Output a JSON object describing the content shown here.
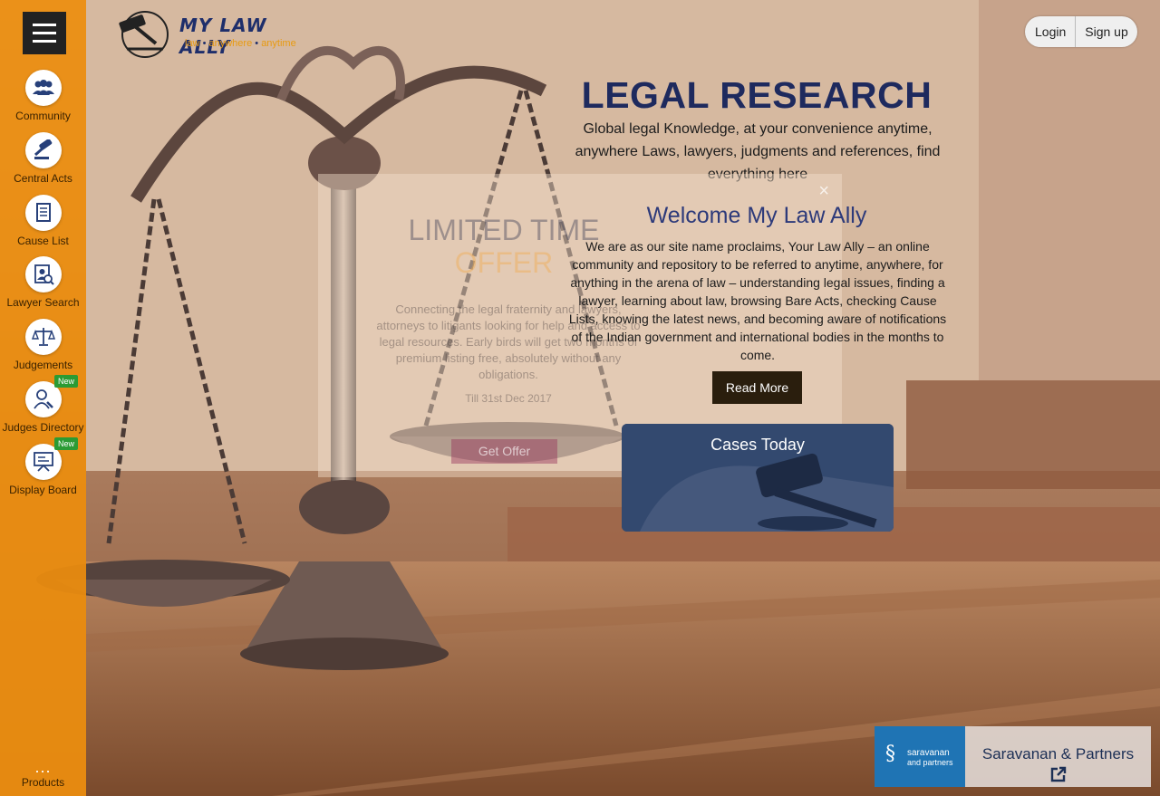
{
  "sidebar": {
    "items": [
      {
        "label": "Community",
        "icon": "community-icon"
      },
      {
        "label": "Central Acts",
        "icon": "gavel-icon"
      },
      {
        "label": "Cause List",
        "icon": "document-list-icon"
      },
      {
        "label": "Lawyer Search",
        "icon": "lawyer-search-icon"
      },
      {
        "label": "Judgements",
        "icon": "scales-icon"
      },
      {
        "label": "Judges Directory",
        "icon": "judge-icon",
        "badge": "New"
      },
      {
        "label": "Display Board",
        "icon": "display-board-icon",
        "badge": "New"
      }
    ],
    "products_label": "Products",
    "more_glyph": "..."
  },
  "logo": {
    "title": "MY LAW ALLY",
    "tagline": [
      "law",
      "anywhere",
      "anytime"
    ],
    "sep": "•"
  },
  "auth": {
    "login": "Login",
    "signup": "Sign up"
  },
  "hero": {
    "title": "LEGAL RESEARCH",
    "subtitle": "Global legal Knowledge, at your convenience anytime, anywhere Laws, lawyers, judgments and references, find everything here"
  },
  "offer_modal": {
    "close": "×",
    "title_line1": "LIMITED TIME",
    "title_line2": "OFFER",
    "text": "Connecting the legal fraternity and lawyers, attorneys to litigants looking for help and access to legal resources. Early birds will get two months of premium listing free, absolutely without any obligations.",
    "date": "Till 31st Dec 2017",
    "button": "Get Offer"
  },
  "welcome": {
    "title": "Welcome My Law Ally",
    "text": "We are as our site name proclaims, Your Law Ally – an online community and repository to be referred to anytime, anywhere, for anything in the arena of law – understanding legal issues, finding a lawyer, learning about law, browsing Bare Acts, checking Cause Lists, knowing the latest news, and becoming aware of notifications of the Indian government and international bodies in the months to come.",
    "button": "Read More"
  },
  "cases_today": {
    "title": "Cases Today"
  },
  "partner_ad": {
    "logo_line1": "saravanan",
    "logo_line2": "and partners",
    "name": "Saravanan & Partners"
  },
  "colors": {
    "sidebar": "#ec8d0e",
    "brand_navy": "#1e2a5e",
    "badge_green": "#2b9b34",
    "ad_blue": "#1f74b4"
  }
}
